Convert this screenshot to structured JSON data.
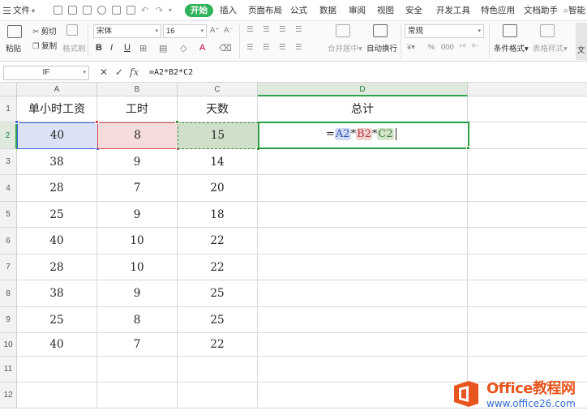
{
  "menubar": {
    "file_label": "文件",
    "tabs": [
      "开始",
      "插入",
      "页面布局",
      "公式",
      "数据",
      "审阅",
      "视图",
      "安全",
      "开发工具",
      "特色应用",
      "文档助手"
    ],
    "active_tab_index": 0,
    "search_label": "智能"
  },
  "ribbon": {
    "paste": "粘贴",
    "cut": "剪切",
    "copy": "复制",
    "format_painter": "格式刷",
    "font_name": "宋体",
    "font_size": "16",
    "bold": "B",
    "italic": "I",
    "underline": "U",
    "font_color_letter": "A",
    "merge_center": "合并居中",
    "wrap_text": "自动换行",
    "number_format": "常规",
    "percent": "%",
    "conditional_format": "条件格式",
    "table_style": "表格样式",
    "more": "文"
  },
  "formula_bar": {
    "name_box": "IF",
    "cancel": "✕",
    "confirm": "✓",
    "fx": "fx",
    "content": "=A2*B2*C2"
  },
  "columns": [
    "A",
    "B",
    "C",
    "D"
  ],
  "rows": [
    "1",
    "2",
    "3",
    "4",
    "5",
    "6",
    "7",
    "8",
    "9",
    "10",
    "11",
    "12"
  ],
  "headers": [
    "单小时工资",
    "工时",
    "天数",
    "总计"
  ],
  "data": [
    [
      "40",
      "8",
      "15"
    ],
    [
      "38",
      "9",
      "14"
    ],
    [
      "28",
      "7",
      "20"
    ],
    [
      "25",
      "9",
      "18"
    ],
    [
      "40",
      "10",
      "22"
    ],
    [
      "28",
      "10",
      "22"
    ],
    [
      "38",
      "9",
      "25"
    ],
    [
      "25",
      "8",
      "25"
    ],
    [
      "40",
      "7",
      "22"
    ]
  ],
  "editing_formula": {
    "eq": "=",
    "ref_a": "A2",
    "op1": "*",
    "ref_b": "B2",
    "op2": "*",
    "ref_c": "C2"
  },
  "watermark": {
    "title": "Office教程网",
    "url": "www.office26.com"
  },
  "colors": {
    "accent_green": "#2fb35a",
    "ref_blue": "#3d5fd6",
    "ref_red": "#d24f4f",
    "ref_green": "#3f8e3f",
    "watermark_orange": "#e8551e"
  }
}
